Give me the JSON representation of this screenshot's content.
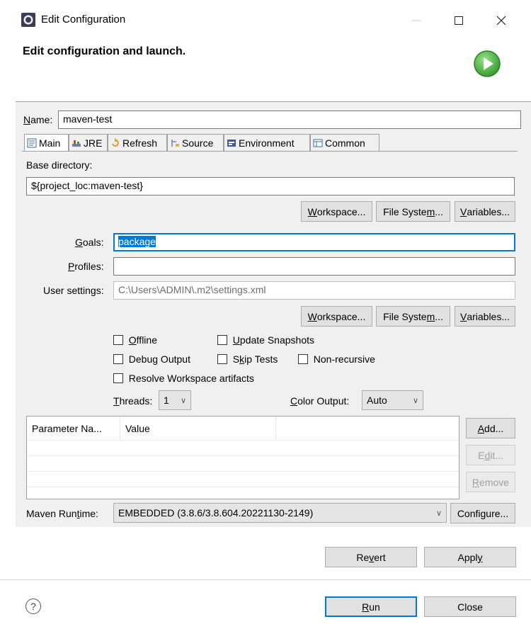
{
  "window": {
    "title": "Edit Configuration",
    "header": "Edit configuration and launch."
  },
  "name_field": {
    "label": "Name:",
    "value": "maven-test"
  },
  "tabs": [
    {
      "label": "Main",
      "icon": "main-tab-icon",
      "active": true
    },
    {
      "label": "JRE",
      "icon": "jre-icon"
    },
    {
      "label": "Refresh",
      "icon": "refresh-icon"
    },
    {
      "label": "Source",
      "icon": "source-icon"
    },
    {
      "label": "Environment",
      "icon": "environment-icon"
    },
    {
      "label": "Common",
      "icon": "common-icon"
    }
  ],
  "base_directory": {
    "label": "Base directory:",
    "value": "${project_loc:maven-test}",
    "buttons": {
      "workspace": "Workspace...",
      "file_system": "File System...",
      "variables": "Variables..."
    }
  },
  "goals": {
    "label": "Goals:",
    "value": "package"
  },
  "profiles": {
    "label": "Profiles:",
    "value": ""
  },
  "user_settings": {
    "label": "User settings:",
    "value": "C:\\Users\\ADMIN\\.m2\\settings.xml",
    "buttons": {
      "workspace": "Workspace...",
      "file_system": "File System...",
      "variables": "Variables..."
    }
  },
  "options": {
    "offline": "Offline",
    "update_snapshots": "Update Snapshots",
    "debug_output": "Debug Output",
    "skip_tests": "Skip Tests",
    "non_recursive": "Non-recursive",
    "resolve_workspace": "Resolve Workspace artifacts"
  },
  "threads": {
    "label": "Threads:",
    "value": "1"
  },
  "color_output": {
    "label": "Color Output:",
    "value": "Auto"
  },
  "param_table": {
    "columns": [
      "Parameter Na...",
      "Value"
    ],
    "buttons": {
      "add": "Add...",
      "edit": "Edit...",
      "remove": "Remove"
    }
  },
  "maven_runtime": {
    "label": "Maven Runtime:",
    "value": "EMBEDDED (3.8.6/3.8.604.20221130-2149)",
    "configure": "Configure..."
  },
  "footer": {
    "revert": "Revert",
    "apply": "Apply",
    "run": "Run",
    "close": "Close"
  }
}
